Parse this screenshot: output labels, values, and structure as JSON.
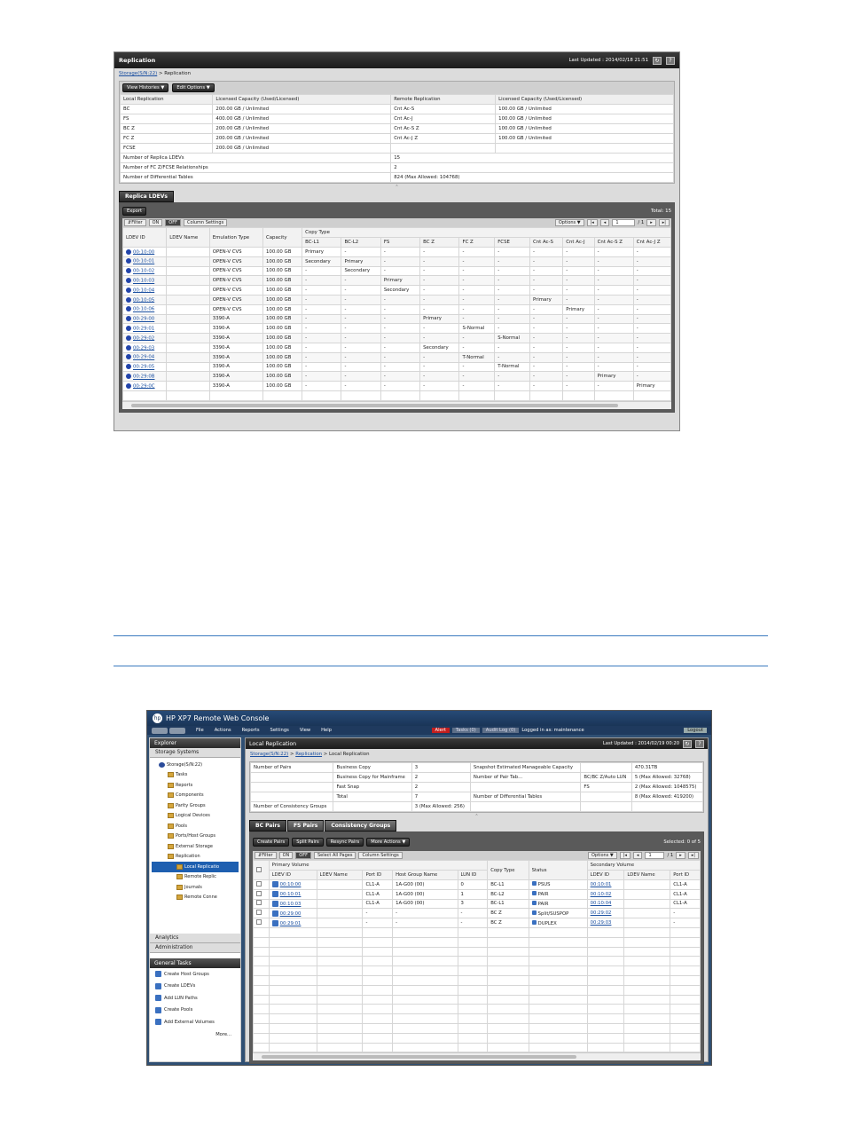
{
  "s1": {
    "title": "Replication",
    "last_updated": "Last Updated : 2014/02/18 21:51",
    "crumb_link": "Storage(S/N:22)",
    "crumb_rest": " > Replication",
    "btn_view_histories": "View Histories",
    "btn_edit_options": "Edit Options",
    "summary_headers": [
      "Local Replication",
      "Licensed Capacity (Used/Licensed)",
      "Remote Replication",
      "Licensed Capacity (Used/Licensed)"
    ],
    "summary_rows": [
      [
        "BC",
        "200.00 GB / Unlimited",
        "Cnt Ac-S",
        "100.00 GB / Unlimited"
      ],
      [
        "FS",
        "400.00 GB / Unlimited",
        "Cnt Ac-J",
        "100.00 GB / Unlimited"
      ],
      [
        "BC Z",
        "200.00 GB / Unlimited",
        "Cnt Ac-S Z",
        "100.00 GB / Unlimited"
      ],
      [
        "FC Z",
        "200.00 GB / Unlimited",
        "Cnt Ac-J Z",
        "100.00 GB / Unlimited"
      ],
      [
        "FCSE",
        "200.00 GB / Unlimited",
        "",
        ""
      ]
    ],
    "counts": [
      [
        "Number of Replica LDEVs",
        "15"
      ],
      [
        "Number of FC Z/FCSE Relationships",
        "2"
      ],
      [
        "Number of Differential Tables",
        "824 (Max Allowed: 104768)"
      ]
    ],
    "tab_label": "Replica LDEVs",
    "btn_export": "Export",
    "total": "Total:  15",
    "filter": "⇵Filter",
    "on": "ON",
    "off": "OFF",
    "col_settings": "Column Settings",
    "options": "Options ▼",
    "page_value": "1",
    "page_of": "/ 1",
    "headers": [
      "LDEV ID",
      "LDEV Name",
      "Emulation Type",
      "Capacity"
    ],
    "copy_type": "Copy Type",
    "copy_cols": [
      "BC-L1",
      "BC-L2",
      "FS",
      "BC Z",
      "FC Z",
      "FCSE",
      "Cnt Ac-S",
      "Cnt Ac-J",
      "Cnt Ac-S Z",
      "Cnt Ac-J Z"
    ],
    "rows": [
      [
        "00:10:00",
        "",
        "OPEN-V CVS",
        "100.00 GB",
        "Primary",
        "-",
        "-",
        "-",
        "-",
        "-",
        "-",
        "-",
        "-",
        "-"
      ],
      [
        "00:10:01",
        "",
        "OPEN-V CVS",
        "100.00 GB",
        "Secondary",
        "Primary",
        "-",
        "-",
        "-",
        "-",
        "-",
        "-",
        "-",
        "-"
      ],
      [
        "00:10:02",
        "",
        "OPEN-V CVS",
        "100.00 GB",
        "-",
        "Secondary",
        "-",
        "-",
        "-",
        "-",
        "-",
        "-",
        "-",
        "-"
      ],
      [
        "00:10:03",
        "",
        "OPEN-V CVS",
        "100.00 GB",
        "-",
        "-",
        "Primary",
        "-",
        "-",
        "-",
        "-",
        "-",
        "-",
        "-"
      ],
      [
        "00:10:04",
        "",
        "OPEN-V CVS",
        "100.00 GB",
        "-",
        "-",
        "Secondary",
        "-",
        "-",
        "-",
        "-",
        "-",
        "-",
        "-"
      ],
      [
        "00:10:05",
        "",
        "OPEN-V CVS",
        "100.00 GB",
        "-",
        "-",
        "-",
        "-",
        "-",
        "-",
        "Primary",
        "-",
        "-",
        "-"
      ],
      [
        "00:10:06",
        "",
        "OPEN-V CVS",
        "100.00 GB",
        "-",
        "-",
        "-",
        "-",
        "-",
        "-",
        "-",
        "Primary",
        "-",
        "-"
      ],
      [
        "00:29:00",
        "",
        "3390-A",
        "100.00 GB",
        "-",
        "-",
        "-",
        "Primary",
        "-",
        "-",
        "-",
        "-",
        "-",
        "-"
      ],
      [
        "00:29:01",
        "",
        "3390-A",
        "100.00 GB",
        "-",
        "-",
        "-",
        "-",
        "S-Normal",
        "-",
        "-",
        "-",
        "-",
        "-"
      ],
      [
        "00:29:02",
        "",
        "3390-A",
        "100.00 GB",
        "-",
        "-",
        "-",
        "-",
        "-",
        "S-Normal",
        "-",
        "-",
        "-",
        "-"
      ],
      [
        "00:29:03",
        "",
        "3390-A",
        "100.00 GB",
        "-",
        "-",
        "-",
        "Secondary",
        "-",
        "-",
        "-",
        "-",
        "-",
        "-"
      ],
      [
        "00:29:04",
        "",
        "3390-A",
        "100.00 GB",
        "-",
        "-",
        "-",
        "-",
        "T-Normal",
        "-",
        "-",
        "-",
        "-",
        "-"
      ],
      [
        "00:29:05",
        "",
        "3390-A",
        "100.00 GB",
        "-",
        "-",
        "-",
        "-",
        "-",
        "T-Normal",
        "-",
        "-",
        "-",
        "-"
      ],
      [
        "00:29:0B",
        "",
        "3390-A",
        "100.00 GB",
        "-",
        "-",
        "-",
        "-",
        "-",
        "-",
        "-",
        "-",
        "Primary",
        "-"
      ],
      [
        "00:29:0C",
        "",
        "3390-A",
        "100.00 GB",
        "-",
        "-",
        "-",
        "-",
        "-",
        "-",
        "-",
        "-",
        "-",
        "Primary"
      ]
    ]
  },
  "s2": {
    "app_title": "HP XP7 Remote Web Console",
    "menu": [
      "File",
      "Actions",
      "Reports",
      "Settings",
      "View",
      "Help"
    ],
    "alert": "Alert",
    "tasks": "Tasks (0)",
    "audit": "Audit Log (0)",
    "logged_in": "Logged in as: maintenance",
    "logout": "Logout",
    "explorer": "Explorer",
    "storage_systems": "Storage Systems",
    "tree": [
      "Storage(S/N:22)",
      "Tasks",
      "Reports",
      "Components",
      "Parity Groups",
      "Logical Devices",
      "Pools",
      "Ports/Host Groups",
      "External Storage",
      "Replication",
      "Local Replicatio",
      "Remote Replic",
      "Journals",
      "Remote Conne"
    ],
    "analytics": "Analytics",
    "administration": "Administration",
    "general_tasks": "General Tasks",
    "gtasks": [
      "Create Host Groups",
      "Create LDEVs",
      "Add LUN Paths",
      "Create Pools",
      "Add External Volumes"
    ],
    "more": "More...",
    "panel_title": "Local Replication",
    "last_updated": "Last Updated : 2014/02/19 00:20",
    "crumb_a": "Storage(S/N:22)",
    "crumb_b": "Replication",
    "crumb_c": " > Local Replication",
    "summary": [
      [
        "Number of Pairs",
        "Business Copy",
        "3",
        "Snapshot Estimated Manageable Capacity",
        "",
        "470.31TB"
      ],
      [
        "",
        "Business Copy for Mainframe",
        "2",
        "Number of Pair Tab...",
        "BC/BC Z/Auto LUN",
        "5 (Max Allowed: 32768)"
      ],
      [
        "",
        "Fast Snap",
        "2",
        "",
        "FS",
        "2 (Max Allowed: 1048575)"
      ],
      [
        "",
        "Total",
        "7",
        "Number of Differential Tables",
        "",
        "8 (Max Allowed: 419200)"
      ],
      [
        "Number of Consistency Groups",
        "",
        "3 (Max Allowed: 256)",
        "",
        "",
        ""
      ]
    ],
    "tabs": [
      "BC Pairs",
      "FS Pairs",
      "Consistency Groups"
    ],
    "btns": [
      "Create Pairs",
      "Split Pairs",
      "Resync Pairs",
      "More Actions ▼"
    ],
    "selected": "Selected:  0   of  5",
    "filter": "⇵Filter",
    "on": "ON",
    "off": "OFF",
    "select_all": "Select All Pages",
    "col_settings": "Column Settings",
    "options": "Options ▼",
    "page_value": "1",
    "page_of": "/ 1",
    "primary_volume": "Primary Volume",
    "secondary_volume": "Secondary Volume",
    "headers": [
      "LDEV ID",
      "LDEV Name",
      "Port ID",
      "Host Group Name",
      "LUN ID",
      "Copy Type",
      "Status",
      "LDEV ID",
      "LDEV Name",
      "Port ID"
    ],
    "rows": [
      [
        "00:10:00",
        "",
        "CL1-A",
        "1A-G00 (00)",
        "0",
        "BC-L1",
        "PSUS",
        "00:10:01",
        "",
        "CL1-A"
      ],
      [
        "00:10:01",
        "",
        "CL1-A",
        "1A-G00 (00)",
        "1",
        "BC-L2",
        "PAIR",
        "00:10:02",
        "",
        "CL1-A"
      ],
      [
        "00:10:03",
        "",
        "CL1-A",
        "1A-G00 (00)",
        "3",
        "BC-L1",
        "PAIR",
        "00:10:04",
        "",
        "CL1-A"
      ],
      [
        "00:29:00",
        "",
        "-",
        "-",
        "-",
        "BC Z",
        "Split/SUSPOP",
        "00:29:02",
        "",
        "-"
      ],
      [
        "00:29:01",
        "",
        "-",
        "-",
        "-",
        "BC Z",
        "DUPLEX",
        "00:29:03",
        "",
        "-"
      ]
    ]
  }
}
